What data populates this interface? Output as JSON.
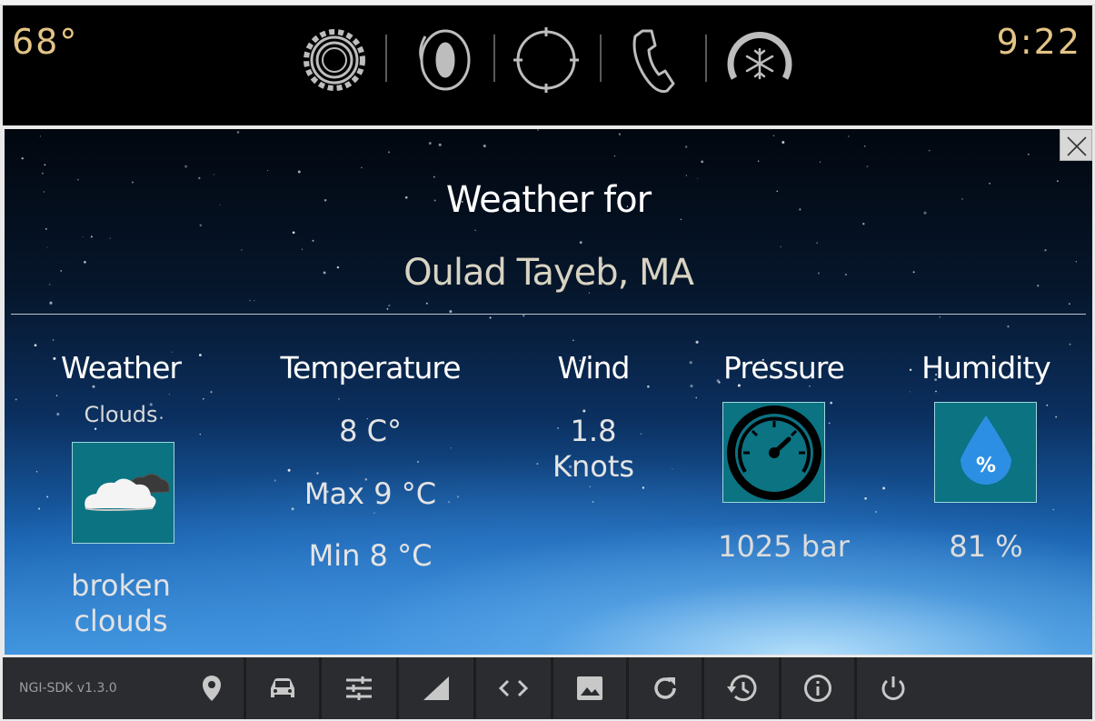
{
  "top_bar": {
    "outside_temp": "68°",
    "clock": "9:22",
    "icons": [
      "settings-gear-icon",
      "audio-speaker-icon",
      "navigation-crosshair-icon",
      "phone-icon",
      "climate-snowflake-icon"
    ]
  },
  "panel": {
    "heading": "Weather for",
    "city": "Oulad Tayeb, MA",
    "weather": {
      "title": "Weather",
      "condition": "Clouds",
      "icon": "broken-clouds-icon",
      "description": "broken clouds"
    },
    "temperature": {
      "title": "Temperature",
      "current": "8 C°",
      "max": "Max 9 °C",
      "min": "Min 8 °C"
    },
    "wind": {
      "title": "Wind",
      "value": "1.8",
      "unit": "Knots"
    },
    "pressure": {
      "title": "Pressure",
      "icon": "pressure-gauge-icon",
      "value": "1025 bar"
    },
    "humidity": {
      "title": "Humidity",
      "icon": "humidity-drop-icon",
      "icon_symbol": "%",
      "value": "81 %"
    },
    "close_icon": "close-icon"
  },
  "bottom_bar": {
    "sdk_version": "NGI-SDK v1.3.0",
    "buttons": [
      "location-pin-icon",
      "car-icon",
      "sliders-icon",
      "signal-icon",
      "code-icon",
      "image-icon",
      "refresh-icon",
      "history-icon",
      "info-icon",
      "power-icon"
    ]
  },
  "colors": {
    "accent_gold": "#e3c486",
    "icon_tile": "#0b7382",
    "topbar_bg": "#000000",
    "bottombar_bg": "#2a2c2f"
  }
}
